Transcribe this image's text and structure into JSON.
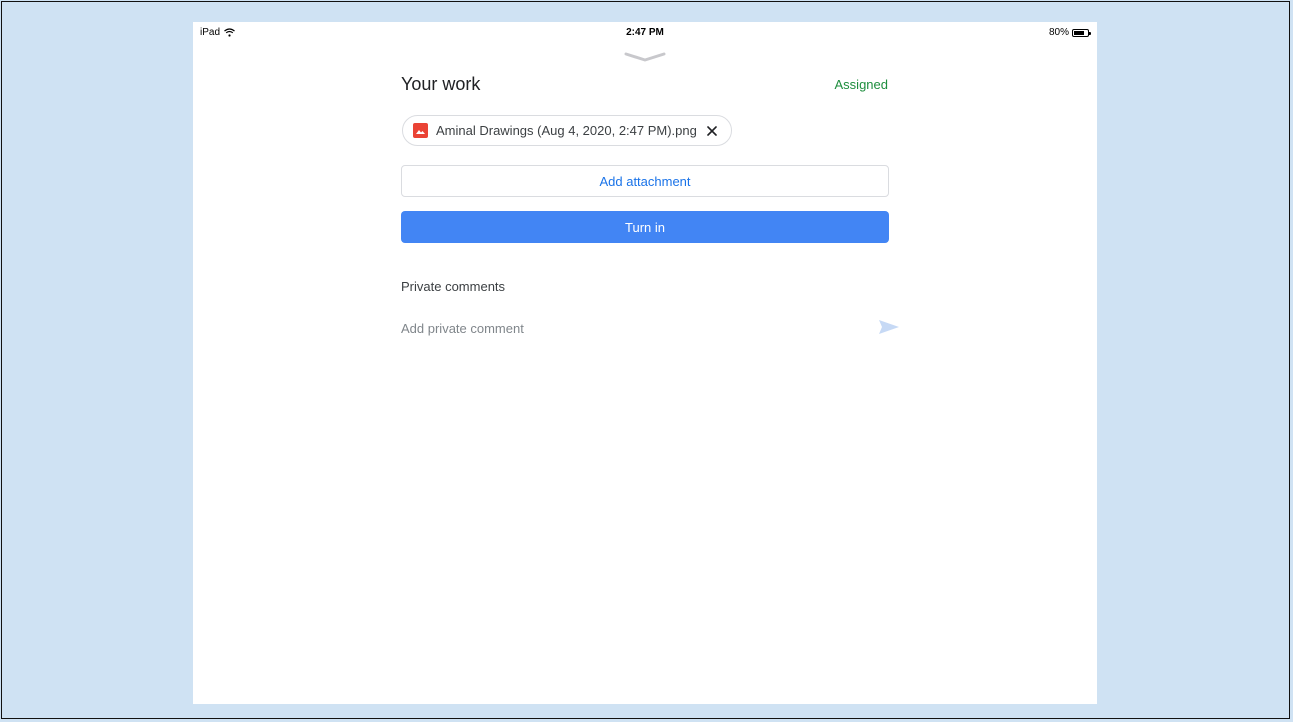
{
  "status_bar": {
    "device": "iPad",
    "time": "2:47 PM",
    "battery": "80%",
    "battery_level": 0.8
  },
  "header": {
    "title": "Your work",
    "status": "Assigned"
  },
  "attachment": {
    "filename": "Aminal Drawings (Aug 4, 2020, 2:47 PM).png",
    "icon": "image-icon"
  },
  "buttons": {
    "add_attachment": "Add attachment",
    "turn_in": "Turn in"
  },
  "comments": {
    "heading": "Private comments",
    "placeholder": "Add private comment"
  },
  "colors": {
    "background": "#cfe2f3",
    "status_green": "#1e8e3e",
    "primary_blue": "#4285f4",
    "link_blue": "#1a73e8",
    "arrow_red": "#ff0000",
    "image_icon_red": "#ea4335"
  }
}
